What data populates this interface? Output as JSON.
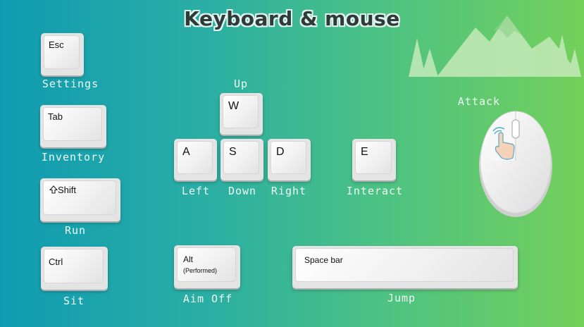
{
  "title": "Keyboard & mouse",
  "keys": {
    "esc": {
      "label": "Esc",
      "action": "Settings"
    },
    "tab": {
      "label": "Tab",
      "action": "Inventory"
    },
    "shift": {
      "label": "Shift",
      "action": "Run",
      "icon": "shift-arrow-icon"
    },
    "ctrl": {
      "label": "Ctrl",
      "action": "Sit"
    },
    "w": {
      "label": "W",
      "action": "Up"
    },
    "a": {
      "label": "A",
      "action": "Left"
    },
    "s": {
      "label": "S",
      "action": "Down"
    },
    "d": {
      "label": "D",
      "action": "Right"
    },
    "e": {
      "label": "E",
      "action": "Interact"
    },
    "alt": {
      "label": "Alt",
      "sub": "(Performed)",
      "action": "Aim Off"
    },
    "space": {
      "label": "Space bar",
      "action": "Jump"
    }
  },
  "mouse": {
    "action": "Attack",
    "icon": "mouse-left-click-icon"
  },
  "decor": {
    "icon": "mountain-forest-icon"
  },
  "colors": {
    "bg_left": "#0f9bb1",
    "bg_right": "#74d05a",
    "key": "#f1f1f1",
    "caption": "#eef9f4",
    "title": "#2f3a3a"
  }
}
